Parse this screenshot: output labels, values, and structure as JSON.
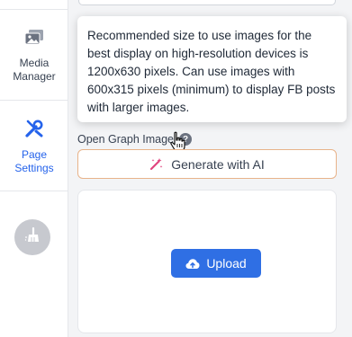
{
  "sidebar": {
    "items": [
      {
        "label_line1": "Media",
        "label_line2": "Manager",
        "icon": "images-icon"
      },
      {
        "label_line1": "Page",
        "label_line2": "Settings",
        "icon": "tools-icon",
        "active": true
      }
    ],
    "bottom_icon": "broom-icon"
  },
  "tooltip": {
    "text": "Recommended size to use images for the best display on high-resolution devices is 1200x630 pixels. Can use images with 600x315 pixels (minimum) to display FB posts with larger images."
  },
  "og_image": {
    "label": "Open Graph Image",
    "help_icon": "question-icon",
    "generate_label": "Generate with AI",
    "upload_label": "Upload"
  },
  "colors": {
    "active": "#2563eb",
    "primary_button": "#2f6fe4",
    "ai_accent": "#e0447f"
  }
}
